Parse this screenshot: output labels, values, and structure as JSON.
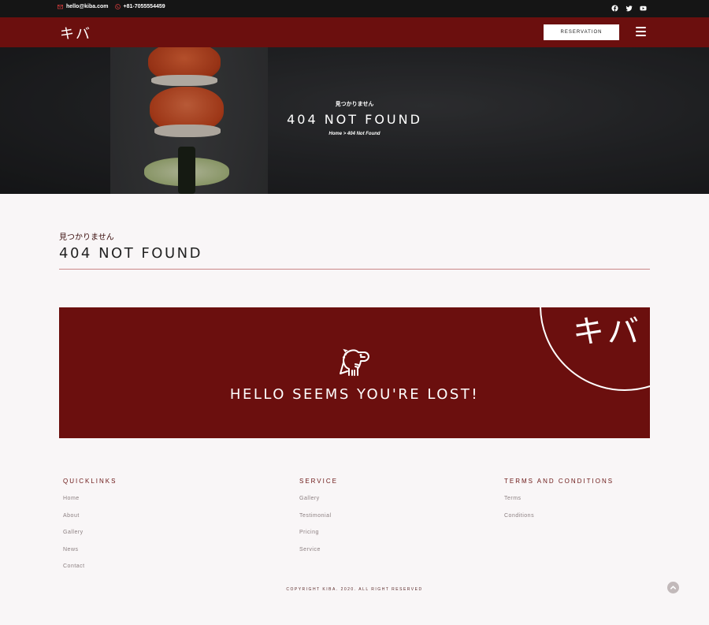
{
  "topbar": {
    "email": "hello@kiba.com",
    "phone": "+81-7055554459",
    "social_icons": [
      "facebook-icon",
      "twitter-icon",
      "youtube-icon"
    ]
  },
  "nav": {
    "logo": "キバ",
    "reservation_label": "RESERVATION",
    "menu_icon": "hamburger-icon"
  },
  "hero": {
    "subtitle": "見つかりません",
    "title": "404 NOT FOUND",
    "breadcrumb": "Home > 404 Not Found"
  },
  "content": {
    "subtitle": "見つかりません",
    "title": "404 NOT FOUND"
  },
  "lost_panel": {
    "logo": "キバ",
    "message": "HELLO SEEMS YOU'RE LOST!",
    "icon": "dinosaur-icon"
  },
  "footer": {
    "quicklinks": {
      "heading": "QUICKLINKS",
      "items": [
        "Home",
        "About",
        "Gallery",
        "News",
        "Contact"
      ]
    },
    "service": {
      "heading": "SERVICE",
      "items": [
        "Gallery",
        "Testimonial",
        "Pricing",
        "Service"
      ]
    },
    "terms": {
      "heading": "TERMS AND CONDITIONS",
      "items": [
        "Terms",
        "Conditions"
      ]
    },
    "copyright": "COPYRIGHT KIBA. 2020. ALL RIGHT RESERVED"
  },
  "colors": {
    "brand": "#6b0f0e",
    "topbar": "#151515",
    "background": "#f9f6f7",
    "accent_icon": "#d23b3b"
  }
}
